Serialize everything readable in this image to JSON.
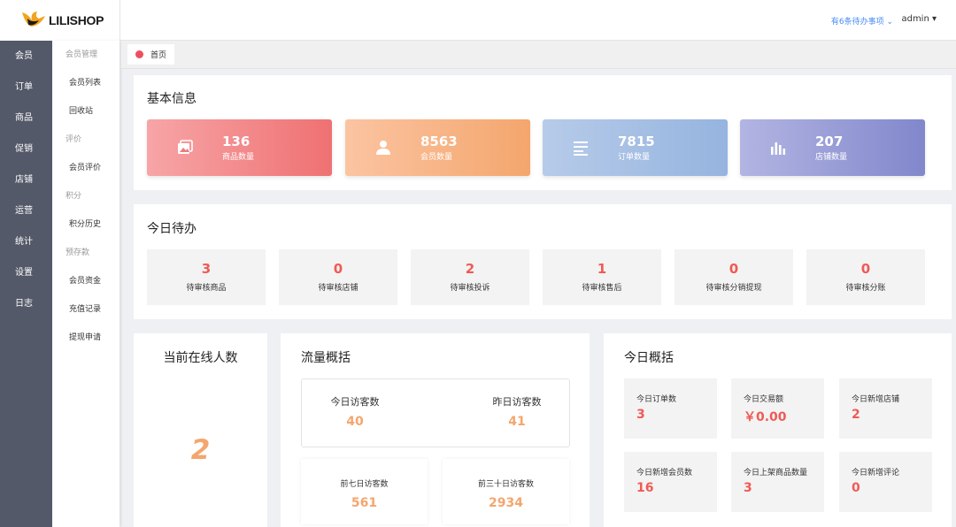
{
  "brand": {
    "name": "LILISHOP"
  },
  "header": {
    "todo_link": "有6条待办事项 ⌄",
    "user": "admin ▾"
  },
  "nav_primary": [
    "会员",
    "订单",
    "商品",
    "促销",
    "店铺",
    "运营",
    "统计",
    "设置",
    "日志"
  ],
  "nav_secondary": [
    {
      "type": "group",
      "label": "会员管理"
    },
    {
      "type": "item",
      "label": "会员列表"
    },
    {
      "type": "item",
      "label": "回收站"
    },
    {
      "type": "group",
      "label": "评价"
    },
    {
      "type": "item",
      "label": "会员评价"
    },
    {
      "type": "group",
      "label": "积分"
    },
    {
      "type": "item",
      "label": "积分历史"
    },
    {
      "type": "group",
      "label": "预存款"
    },
    {
      "type": "item",
      "label": "会员资金"
    },
    {
      "type": "item",
      "label": "充值记录"
    },
    {
      "type": "item",
      "label": "提现申请"
    }
  ],
  "tabs": [
    {
      "label": "首页",
      "dot_color": "#ed4f5f"
    }
  ],
  "basic_info": {
    "title": "基本信息",
    "stats": [
      {
        "value": "136",
        "label": "商品数量",
        "icon": "images-icon"
      },
      {
        "value": "8563",
        "label": "会员数量",
        "icon": "user-icon"
      },
      {
        "value": "7815",
        "label": "订单数量",
        "icon": "list-icon"
      },
      {
        "value": "207",
        "label": "店铺数量",
        "icon": "bar-chart-icon"
      }
    ]
  },
  "today_todo": {
    "title": "今日待办",
    "items": [
      {
        "value": "3",
        "label": "待审核商品"
      },
      {
        "value": "0",
        "label": "待审核店铺"
      },
      {
        "value": "2",
        "label": "待审核投诉"
      },
      {
        "value": "1",
        "label": "待审核售后"
      },
      {
        "value": "0",
        "label": "待审核分销提现"
      },
      {
        "value": "0",
        "label": "待审核分账"
      }
    ]
  },
  "online": {
    "title": "当前在线人数",
    "value": "2"
  },
  "traffic": {
    "title": "流量概括",
    "today_label": "今日访客数",
    "today_value": "40",
    "yesterday_label": "昨日访客数",
    "yesterday_value": "41",
    "week_label": "前七日访客数",
    "week_value": "561",
    "month_label": "前三十日访客数",
    "month_value": "2934"
  },
  "today_overview": {
    "title": "今日概括",
    "items": [
      {
        "label": "今日订单数",
        "value": "3"
      },
      {
        "label": "今日交易额",
        "value": "￥0.00"
      },
      {
        "label": "今日新增店铺",
        "value": "2"
      },
      {
        "label": "今日新增会员数",
        "value": "16"
      },
      {
        "label": "今日上架商品数量",
        "value": "3"
      },
      {
        "label": "今日新增评论",
        "value": "0"
      }
    ]
  },
  "colors": {
    "accent_orange": "#f4a66d",
    "accent_red": "#f05a55",
    "sidebar": "#545969",
    "link": "#4a8cf5"
  }
}
